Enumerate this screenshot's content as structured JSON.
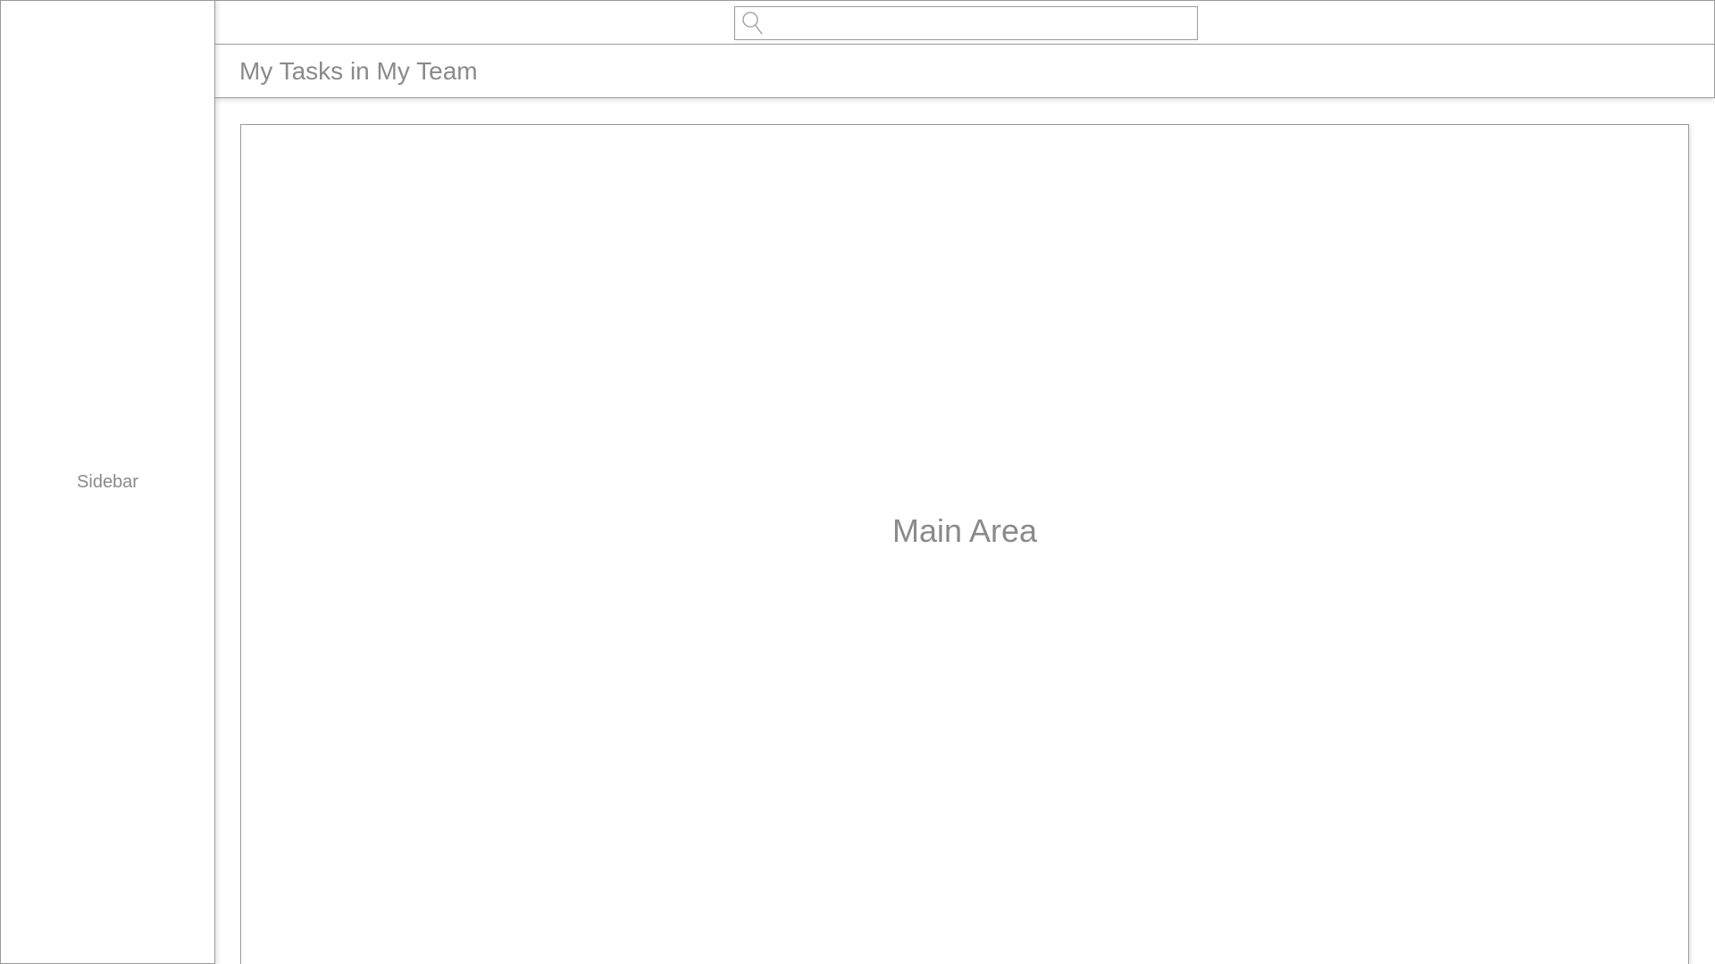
{
  "sidebar": {
    "label": "Sidebar"
  },
  "topbar": {
    "search": {
      "icon": "search-icon",
      "value": "",
      "placeholder": ""
    }
  },
  "header": {
    "title": "My Tasks in My Team"
  },
  "main": {
    "label": "Main Area"
  },
  "colors": {
    "border": "#9a9a9a",
    "text": "#8a8a8a",
    "background": "#ffffff"
  }
}
